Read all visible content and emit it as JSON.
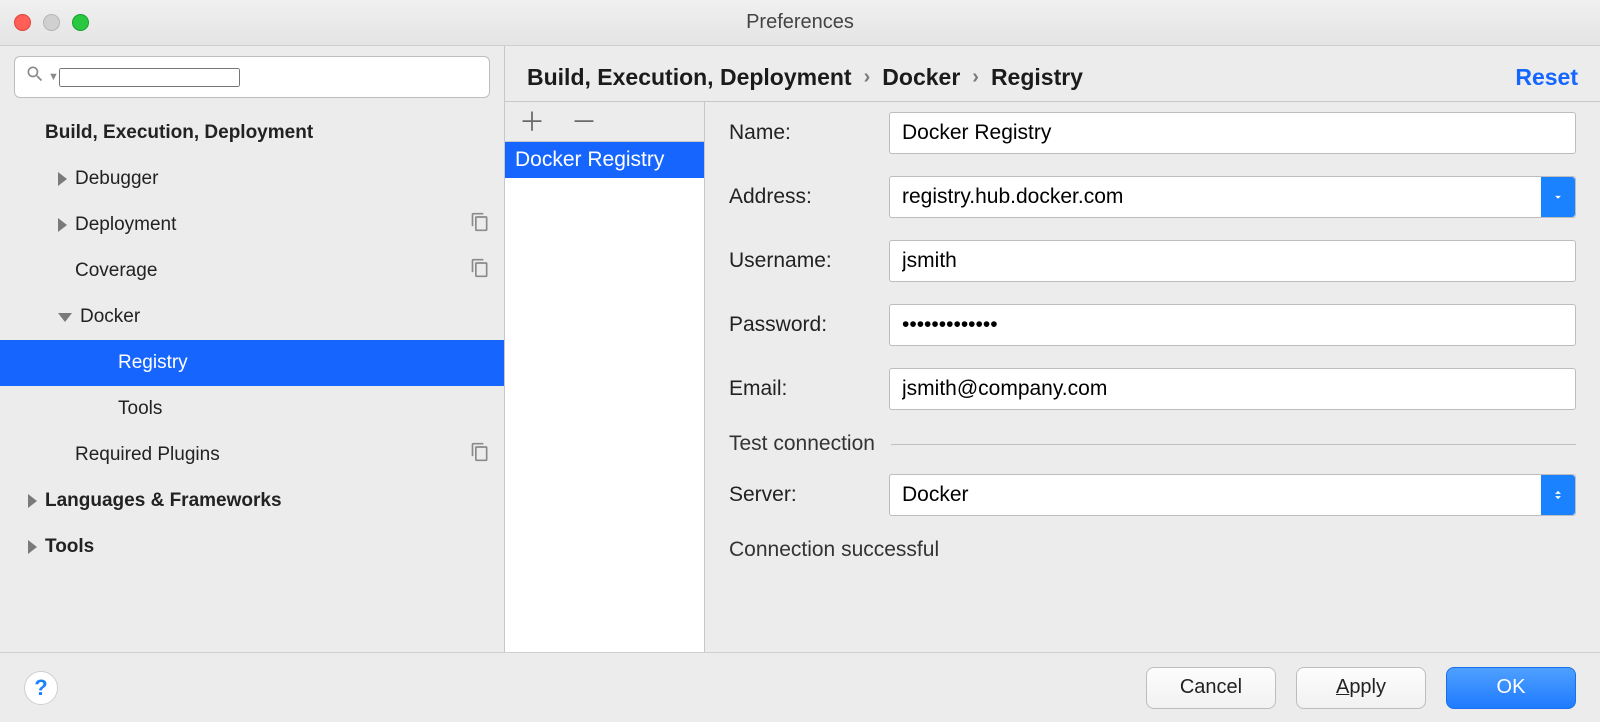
{
  "window": {
    "title": "Preferences"
  },
  "sidebar": {
    "search_placeholder": "",
    "items": {
      "root": "Build, Execution, Deployment",
      "debugger": "Debugger",
      "deployment": "Deployment",
      "coverage": "Coverage",
      "docker": "Docker",
      "registry": "Registry",
      "tools_sub": "Tools",
      "required_plugins": "Required Plugins",
      "languages": "Languages & Frameworks",
      "tools": "Tools"
    }
  },
  "breadcrumb": {
    "a": "Build, Execution, Deployment",
    "b": "Docker",
    "c": "Registry",
    "reset": "Reset"
  },
  "list": {
    "selected": "Docker Registry"
  },
  "form": {
    "name_label": "Name:",
    "name_value": "Docker Registry",
    "address_label": "Address:",
    "address_value": "registry.hub.docker.com",
    "username_label": "Username:",
    "username_value": "jsmith",
    "password_label": "Password:",
    "password_value": "•••••••••••••",
    "email_label": "Email:",
    "email_value": "jsmith@company.com",
    "section": "Test connection",
    "server_label": "Server:",
    "server_value": "Docker",
    "status": "Connection successful"
  },
  "footer": {
    "cancel": "Cancel",
    "apply": "Apply",
    "ok": "OK"
  }
}
